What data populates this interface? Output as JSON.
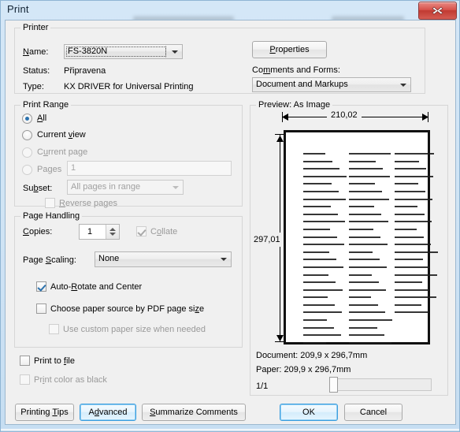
{
  "window": {
    "title": "Print",
    "close_label": "Close"
  },
  "printer": {
    "group_label": "Printer",
    "name_label": "Name:",
    "name_value": "FS-3820N",
    "status_label": "Status:",
    "status_value": "Připravena",
    "type_label": "Type:",
    "type_value": "KX DRIVER for Universal Printing",
    "properties_label": "Properties",
    "comments_label": "Comments and Forms:",
    "comments_value": "Document and Markups"
  },
  "print_range": {
    "group_label": "Print Range",
    "options": [
      {
        "label": "All",
        "selected": true,
        "enabled": true
      },
      {
        "label": "Current view",
        "selected": false,
        "enabled": true
      },
      {
        "label": "Current page",
        "selected": false,
        "enabled": false
      },
      {
        "label": "Pages",
        "selected": false,
        "enabled": false
      }
    ],
    "pages_value": "1",
    "subset_label": "Subset:",
    "subset_value": "All pages in range",
    "reverse_label": "Reverse pages",
    "reverse_checked": false
  },
  "page_handling": {
    "group_label": "Page Handling",
    "copies_label": "Copies:",
    "copies_value": "1",
    "collate_label": "Collate",
    "collate_checked": true,
    "scaling_label": "Page Scaling:",
    "scaling_value": "None",
    "autorotate_label": "Auto-Rotate and Center",
    "autorotate_checked": true,
    "papersource_label": "Choose paper source by PDF page size",
    "papersource_checked": false,
    "customsize_label": "Use custom paper size when needed",
    "customsize_checked": false
  },
  "bottom_options": {
    "print_to_file_label": "Print to file",
    "print_to_file_checked": false,
    "print_color_black_label": "Print color as black",
    "print_color_black_checked": false
  },
  "preview": {
    "group_label": "Preview: As Image",
    "width_mm": "210,02",
    "height_mm": "297,01",
    "document_info": "Document: 209,9 x 296,7mm",
    "paper_info": "Paper: 209,9 x 296,7mm",
    "page_counter": "1/1",
    "content_columns": [
      26,
      26,
      22
    ]
  },
  "buttons": {
    "printing_tips": "Printing Tips",
    "advanced": "Advanced",
    "summarize_comments": "Summarize Comments",
    "ok": "OK",
    "cancel": "Cancel"
  },
  "colors": {
    "accent": "#2c72ad",
    "focus": "#3c9ede",
    "close": "#c03a32",
    "dialog_bg": "#f0f0f0"
  }
}
